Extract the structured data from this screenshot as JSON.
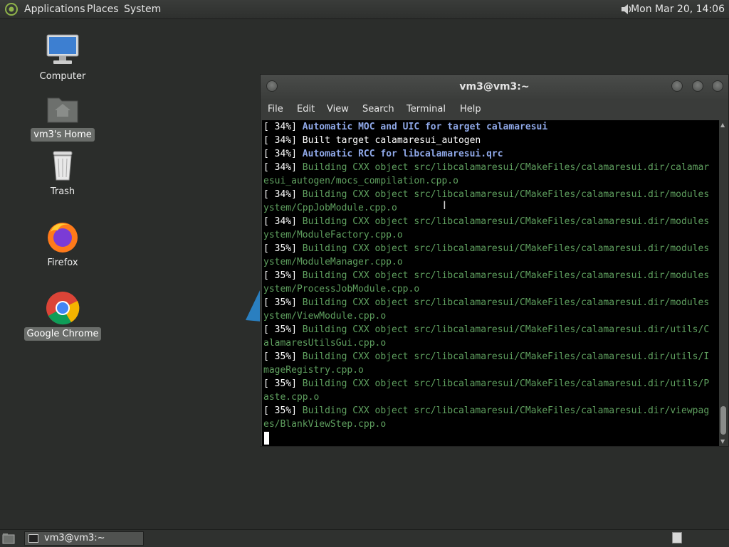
{
  "top_panel": {
    "menus": [
      "Applications",
      "Places",
      "System"
    ],
    "clock": "Mon Mar 20, 14:06",
    "volume_icon": "speaker-icon"
  },
  "desktop": {
    "icons": [
      {
        "label": "Computer",
        "icon": "computer-icon",
        "selected": false
      },
      {
        "label": "vm3's Home",
        "icon": "home-folder-icon",
        "selected": true
      },
      {
        "label": "Trash",
        "icon": "trash-icon",
        "selected": false
      },
      {
        "label": "Firefox",
        "icon": "firefox-icon",
        "selected": false
      },
      {
        "label": "Google Chrome",
        "icon": "chrome-icon",
        "selected": true
      }
    ]
  },
  "terminal": {
    "title": "vm3@vm3:~",
    "menu": [
      "File",
      "Edit",
      "View",
      "Search",
      "Terminal",
      "Help"
    ],
    "lines": [
      {
        "prefix": "[ 34%] ",
        "text": "Automatic MOC and UIC for target calamaresui",
        "style": "moc"
      },
      {
        "prefix": "[ 34%] ",
        "text": "Built target calamaresui_autogen",
        "style": "plain"
      },
      {
        "prefix": "[ 34%] ",
        "text": "Automatic RCC for libcalamaresui.qrc",
        "style": "moc"
      },
      {
        "prefix": "[ 34%] ",
        "text": "Building CXX object src/libcalamaresui/CMakeFiles/calamaresui.dir/calamar",
        "style": "bld"
      },
      {
        "prefix": "",
        "text": "esui_autogen/mocs_compilation.cpp.o",
        "style": "bld"
      },
      {
        "prefix": "[ 34%] ",
        "text": "Building CXX object src/libcalamaresui/CMakeFiles/calamaresui.dir/modules",
        "style": "bld"
      },
      {
        "prefix": "",
        "text": "ystem/CppJobModule.cpp.o",
        "style": "bld"
      },
      {
        "prefix": "[ 34%] ",
        "text": "Building CXX object src/libcalamaresui/CMakeFiles/calamaresui.dir/modules",
        "style": "bld"
      },
      {
        "prefix": "",
        "text": "ystem/ModuleFactory.cpp.o",
        "style": "bld"
      },
      {
        "prefix": "[ 35%] ",
        "text": "Building CXX object src/libcalamaresui/CMakeFiles/calamaresui.dir/modules",
        "style": "bld"
      },
      {
        "prefix": "",
        "text": "ystem/ModuleManager.cpp.o",
        "style": "bld"
      },
      {
        "prefix": "[ 35%] ",
        "text": "Building CXX object src/libcalamaresui/CMakeFiles/calamaresui.dir/modules",
        "style": "bld"
      },
      {
        "prefix": "",
        "text": "ystem/ProcessJobModule.cpp.o",
        "style": "bld"
      },
      {
        "prefix": "[ 35%] ",
        "text": "Building CXX object src/libcalamaresui/CMakeFiles/calamaresui.dir/modules",
        "style": "bld"
      },
      {
        "prefix": "",
        "text": "ystem/ViewModule.cpp.o",
        "style": "bld"
      },
      {
        "prefix": "[ 35%] ",
        "text": "Building CXX object src/libcalamaresui/CMakeFiles/calamaresui.dir/utils/C",
        "style": "bld"
      },
      {
        "prefix": "",
        "text": "alamaresUtilsGui.cpp.o",
        "style": "bld"
      },
      {
        "prefix": "[ 35%] ",
        "text": "Building CXX object src/libcalamaresui/CMakeFiles/calamaresui.dir/utils/I",
        "style": "bld"
      },
      {
        "prefix": "",
        "text": "mageRegistry.cpp.o",
        "style": "bld"
      },
      {
        "prefix": "[ 35%] ",
        "text": "Building CXX object src/libcalamaresui/CMakeFiles/calamaresui.dir/utils/P",
        "style": "bld"
      },
      {
        "prefix": "",
        "text": "aste.cpp.o",
        "style": "bld"
      },
      {
        "prefix": "[ 35%] ",
        "text": "Building CXX object src/libcalamaresui/CMakeFiles/calamaresui.dir/viewpag",
        "style": "bld"
      },
      {
        "prefix": "",
        "text": "es/BlankViewStep.cpp.o",
        "style": "bld"
      }
    ]
  },
  "bottom_panel": {
    "task_label": "vm3@vm3:~",
    "task_icon": "terminal-icon",
    "show_desktop_icon": "show-desktop-icon",
    "workspace_icon": "workspace-switcher-icon"
  }
}
